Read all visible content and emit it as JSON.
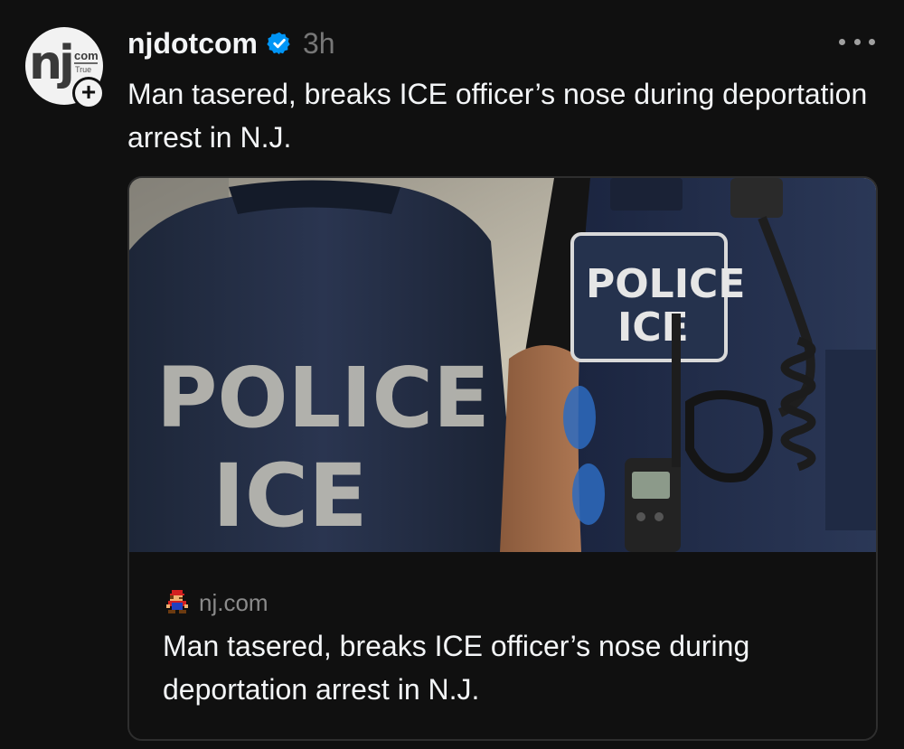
{
  "post": {
    "avatar": {
      "logo_text": "nj",
      "logo_suffix": "com",
      "logo_tagline": "True",
      "follow_symbol": "+"
    },
    "username": "njdotcom",
    "verified_icon": "verified-badge-icon",
    "timestamp": "3h",
    "more_icon": "more-horizontal-icon",
    "caption": "Man tasered, breaks ICE officer’s nose during deportation arrest in N.J."
  },
  "link_card": {
    "image_icon": "photo-ice-officers",
    "favicon_icon": "pixel-mario-favicon",
    "domain": "nj.com",
    "title": "Man tasered, breaks ICE officer’s nose during deportation arrest in N.J.",
    "image_text": {
      "jacket_line1": "POLICE",
      "jacket_line2": "ICE",
      "patch_line1": "POLICE",
      "patch_line2": "ICE"
    }
  },
  "colors": {
    "background": "#101010",
    "text_primary": "#f3f5f7",
    "text_secondary": "#777777",
    "verified_blue": "#0095f6",
    "card_border": "#2e2e2e"
  }
}
